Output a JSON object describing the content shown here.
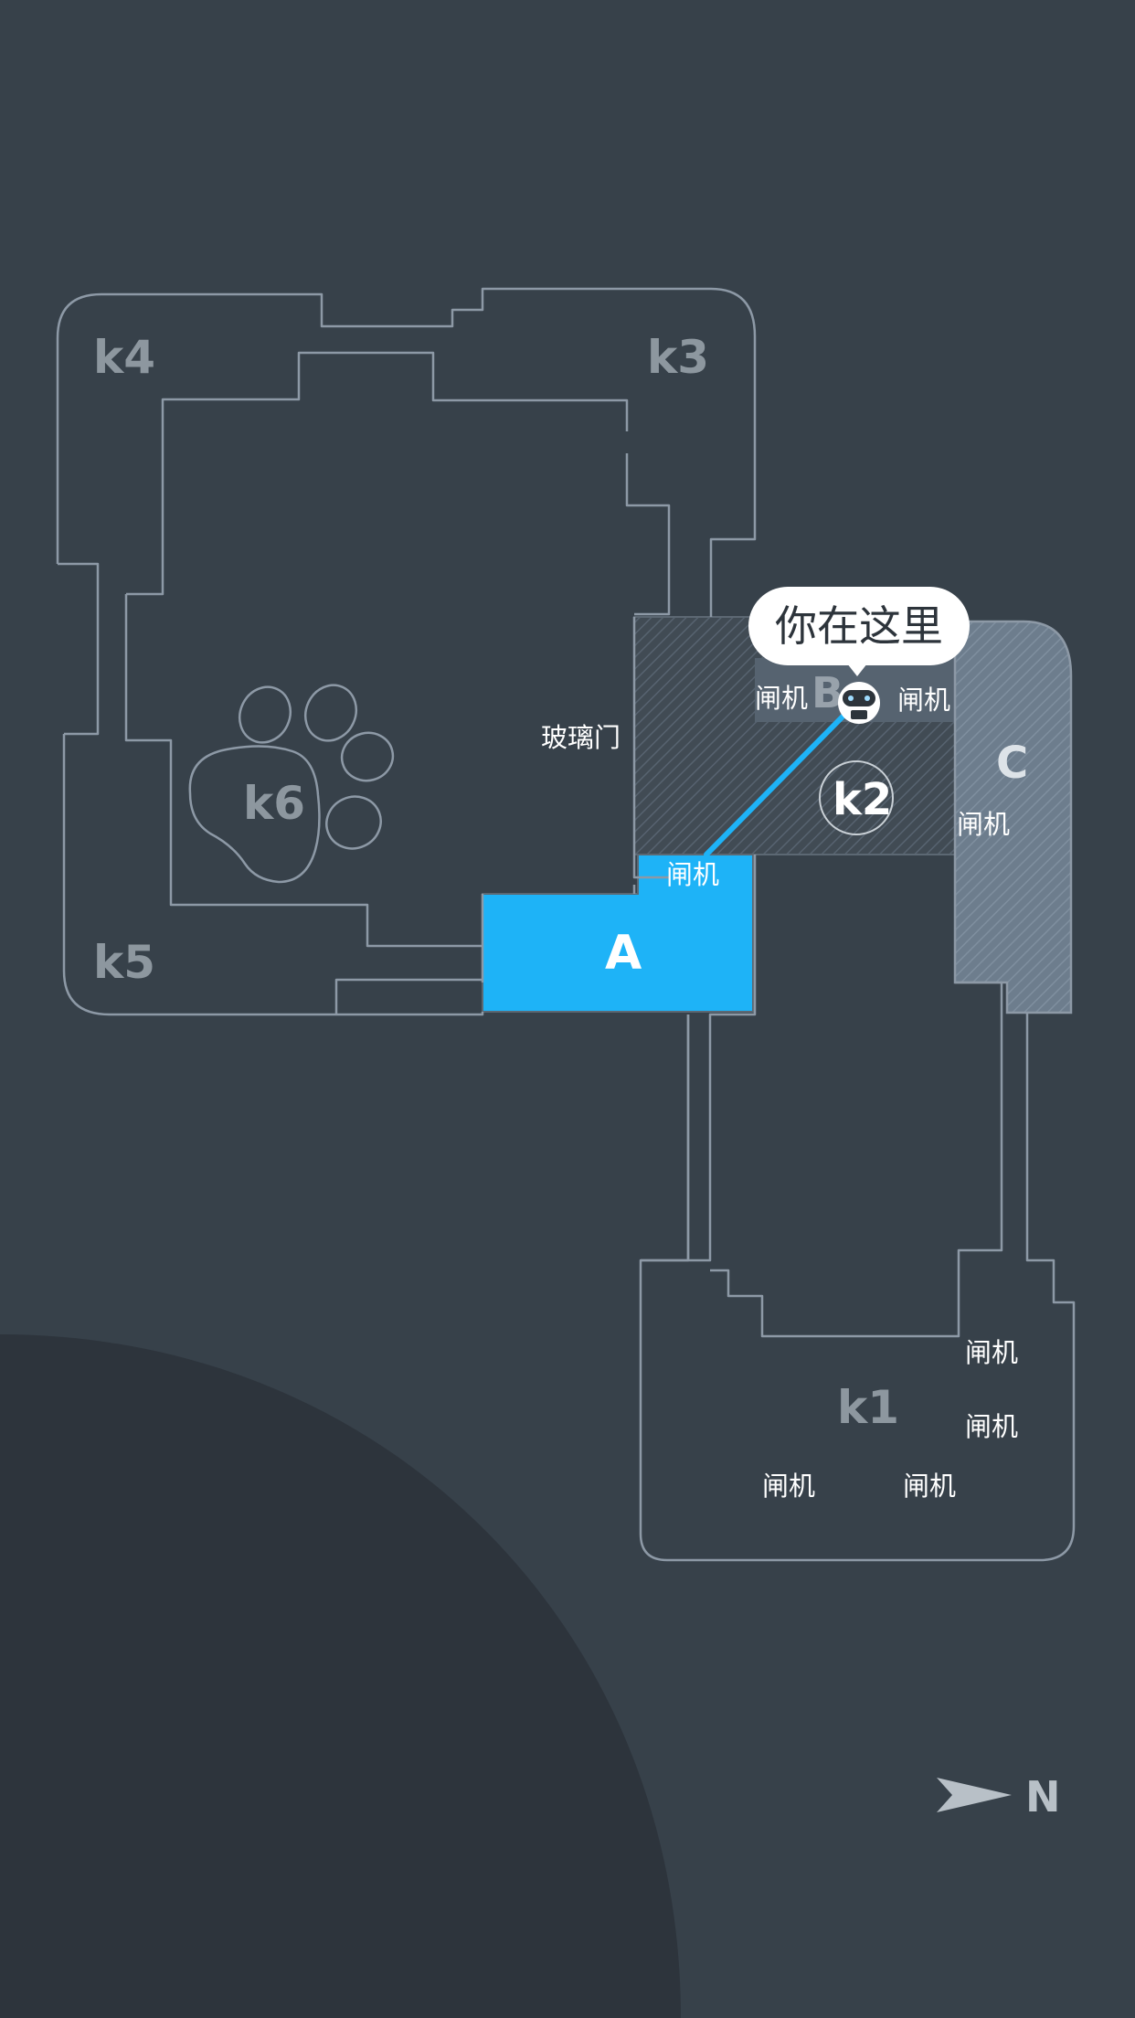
{
  "map": {
    "zones": {
      "k1": "k1",
      "k2": "k2",
      "k3": "k3",
      "k4": "k4",
      "k5": "k5",
      "k6": "k6",
      "a": "A",
      "b": "B",
      "c": "C"
    },
    "gate_label": "闸机",
    "glass_door_label": "玻璃门",
    "you_are_here": "你在这里",
    "compass_north": "N",
    "colors": {
      "background": "#37414a",
      "corner_shade": "#2d343c",
      "outline": "#8d99a6",
      "highlight_zone": "#1eb3f7",
      "route_line": "#1eb3f7",
      "hatched_zone": "#414b54",
      "zone_c": "#6e7e8e"
    },
    "icons": {
      "location": "robot-marker-icon",
      "pet_area": "paw-icon",
      "compass": "north-arrow-icon"
    }
  }
}
